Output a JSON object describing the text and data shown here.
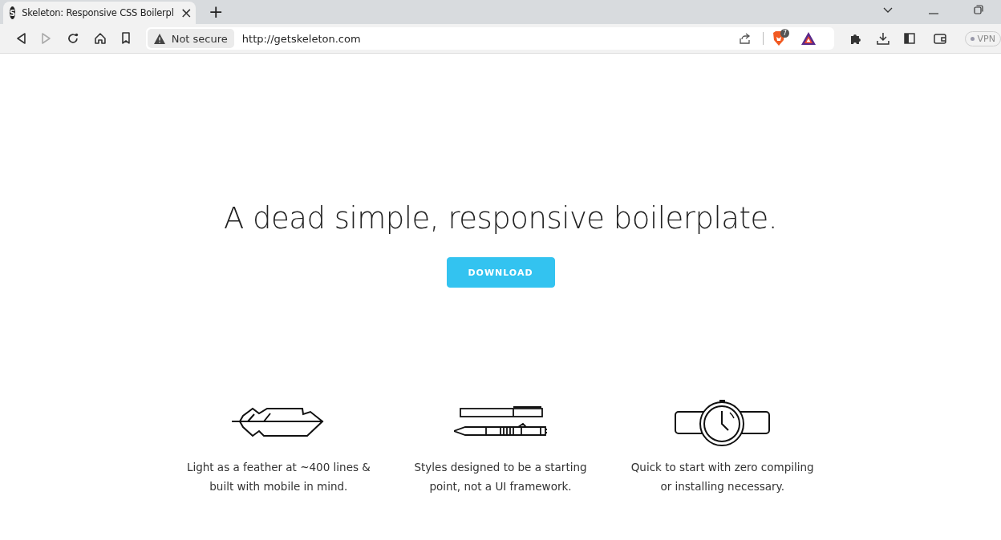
{
  "tab": {
    "favicon": "S",
    "title": "Skeleton: Responsive CSS Boilerpl",
    "close": "×",
    "new_tab": "+"
  },
  "address_bar": {
    "security": "Not secure",
    "url": "http://getskeleton.com"
  },
  "shields_count": "7",
  "vpn": "VPN",
  "hero": {
    "heading": "A dead simple, responsive boilerplate.",
    "button": "DOWNLOAD"
  },
  "features": [
    {
      "kind": "feather",
      "lines": [
        "Light as a feather at ~400 lines &",
        "built with mobile in mind."
      ]
    },
    {
      "kind": "pens",
      "lines": [
        "Styles designed to be a starting",
        "point, not a UI framework."
      ]
    },
    {
      "kind": "watch",
      "lines": [
        "Quick to start with zero compiling",
        "or installing necessary."
      ]
    }
  ]
}
